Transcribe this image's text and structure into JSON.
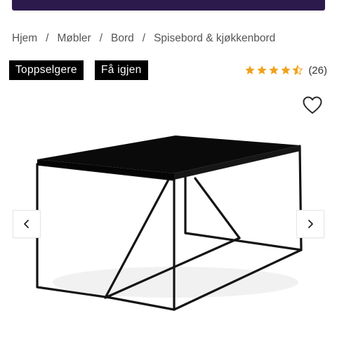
{
  "breadcrumb": {
    "items": [
      "Hjem",
      "Møbler",
      "Bord",
      "Spisebord & kjøkkenbord"
    ],
    "separator": "/"
  },
  "badges": [
    "Toppselgere",
    "Få igjen"
  ],
  "rating": {
    "value": 4.5,
    "max": 5,
    "count_label": "(26)",
    "star_color": "#f0a21b"
  },
  "colors": {
    "top_bar": "#2d1a4d",
    "badge_bg": "#000000",
    "badge_text": "#ffffff"
  },
  "icons": {
    "favorite": "heart-outline-icon",
    "prev": "chevron-left-icon",
    "next": "chevron-right-icon"
  },
  "product_image": {
    "subject": "black rectangular dining table with thin metal frame legs"
  }
}
